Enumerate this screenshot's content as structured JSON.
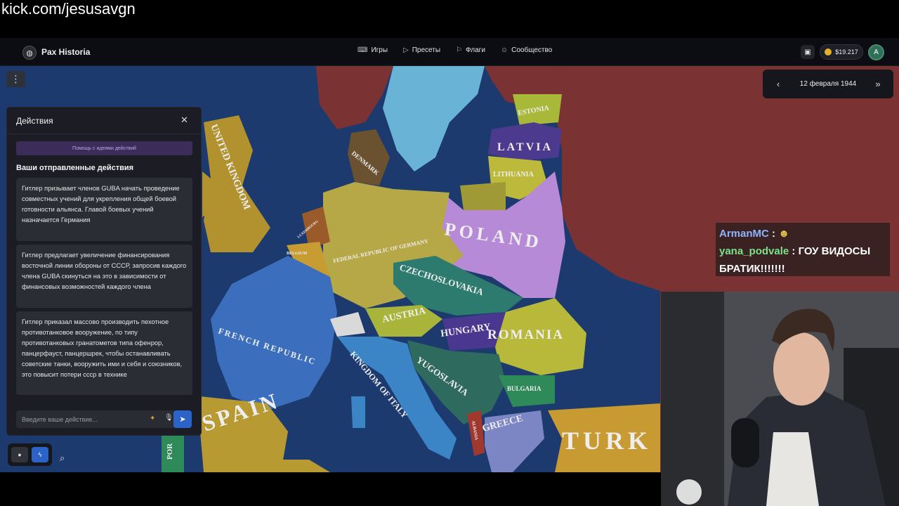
{
  "stream": {
    "watermark": "kick.com/jesusavgn"
  },
  "topbar": {
    "brand": "Pax Historia",
    "nav": [
      {
        "label": "Игры",
        "icon": "gamepad-icon"
      },
      {
        "label": "Пресеты",
        "icon": "play-icon"
      },
      {
        "label": "Флаги",
        "icon": "flag-icon"
      },
      {
        "label": "Сообщество",
        "icon": "community-icon"
      }
    ],
    "balance": "$19.217",
    "avatar_letter": "A"
  },
  "date_panel": {
    "date": "12 февраля 1944"
  },
  "actions": {
    "title": "Действия",
    "help_label": "Помощь с идеями действий",
    "sent_title": "Ваши отправленные действия",
    "items": [
      "Гитлер призывает членов GUBA начать проведение совместных учений для укрепления общей боевой готовности альянса. Главой боевых учений назначается Германия",
      "Гитлер предлагает увеличение финансирования восточной линии обороны от СССР, запросив каждого члена GUBA скинуться на это в зависимости от финансовых возможностей каждого члена",
      "Гитлер приказал массово производить пехотное противотанковое вооружение, по типу противотанковых гранатометов типа офенрор, панцерфауст, панцершрек, чтобы останавливать советские танки, вооружить ими и себя и союзников, это повысит потери ссср в технике"
    ],
    "input_placeholder": "Введите ваше действие..."
  },
  "map": {
    "labels": [
      "UNITED KINGDOM",
      "DENMARK",
      "LATVIA",
      "LITHUANIA",
      "ESTONIA",
      "POLAND",
      "FEDERAL REPUBLIC OF GERMANY",
      "CZECHOSLOVAKIA",
      "AUSTRIA",
      "HUNGARY",
      "ROMANIA",
      "FRENCH REPUBLIC",
      "KINGDOM OF ITALY",
      "YUGOSLAVIA",
      "BULGARIA",
      "ALBANIA",
      "GREECE",
      "SPAIN",
      "TURK",
      "POR",
      "LUXEMBOURG",
      "BELGIUM"
    ]
  },
  "chat": {
    "lines": [
      {
        "user": "ArmanMC",
        "message": ""
      },
      {
        "user": "yana_podvale",
        "message": "ГОУ ВИДОСЫ БРАТИК!!!!!!!"
      }
    ]
  },
  "colors": {
    "ocean": "#1c3a6e",
    "ussr": "#7a3232",
    "germany": "#b6a747",
    "poland": "#b68ad6",
    "france": "#3b6fbd",
    "accent_blue": "#2b63c9"
  }
}
